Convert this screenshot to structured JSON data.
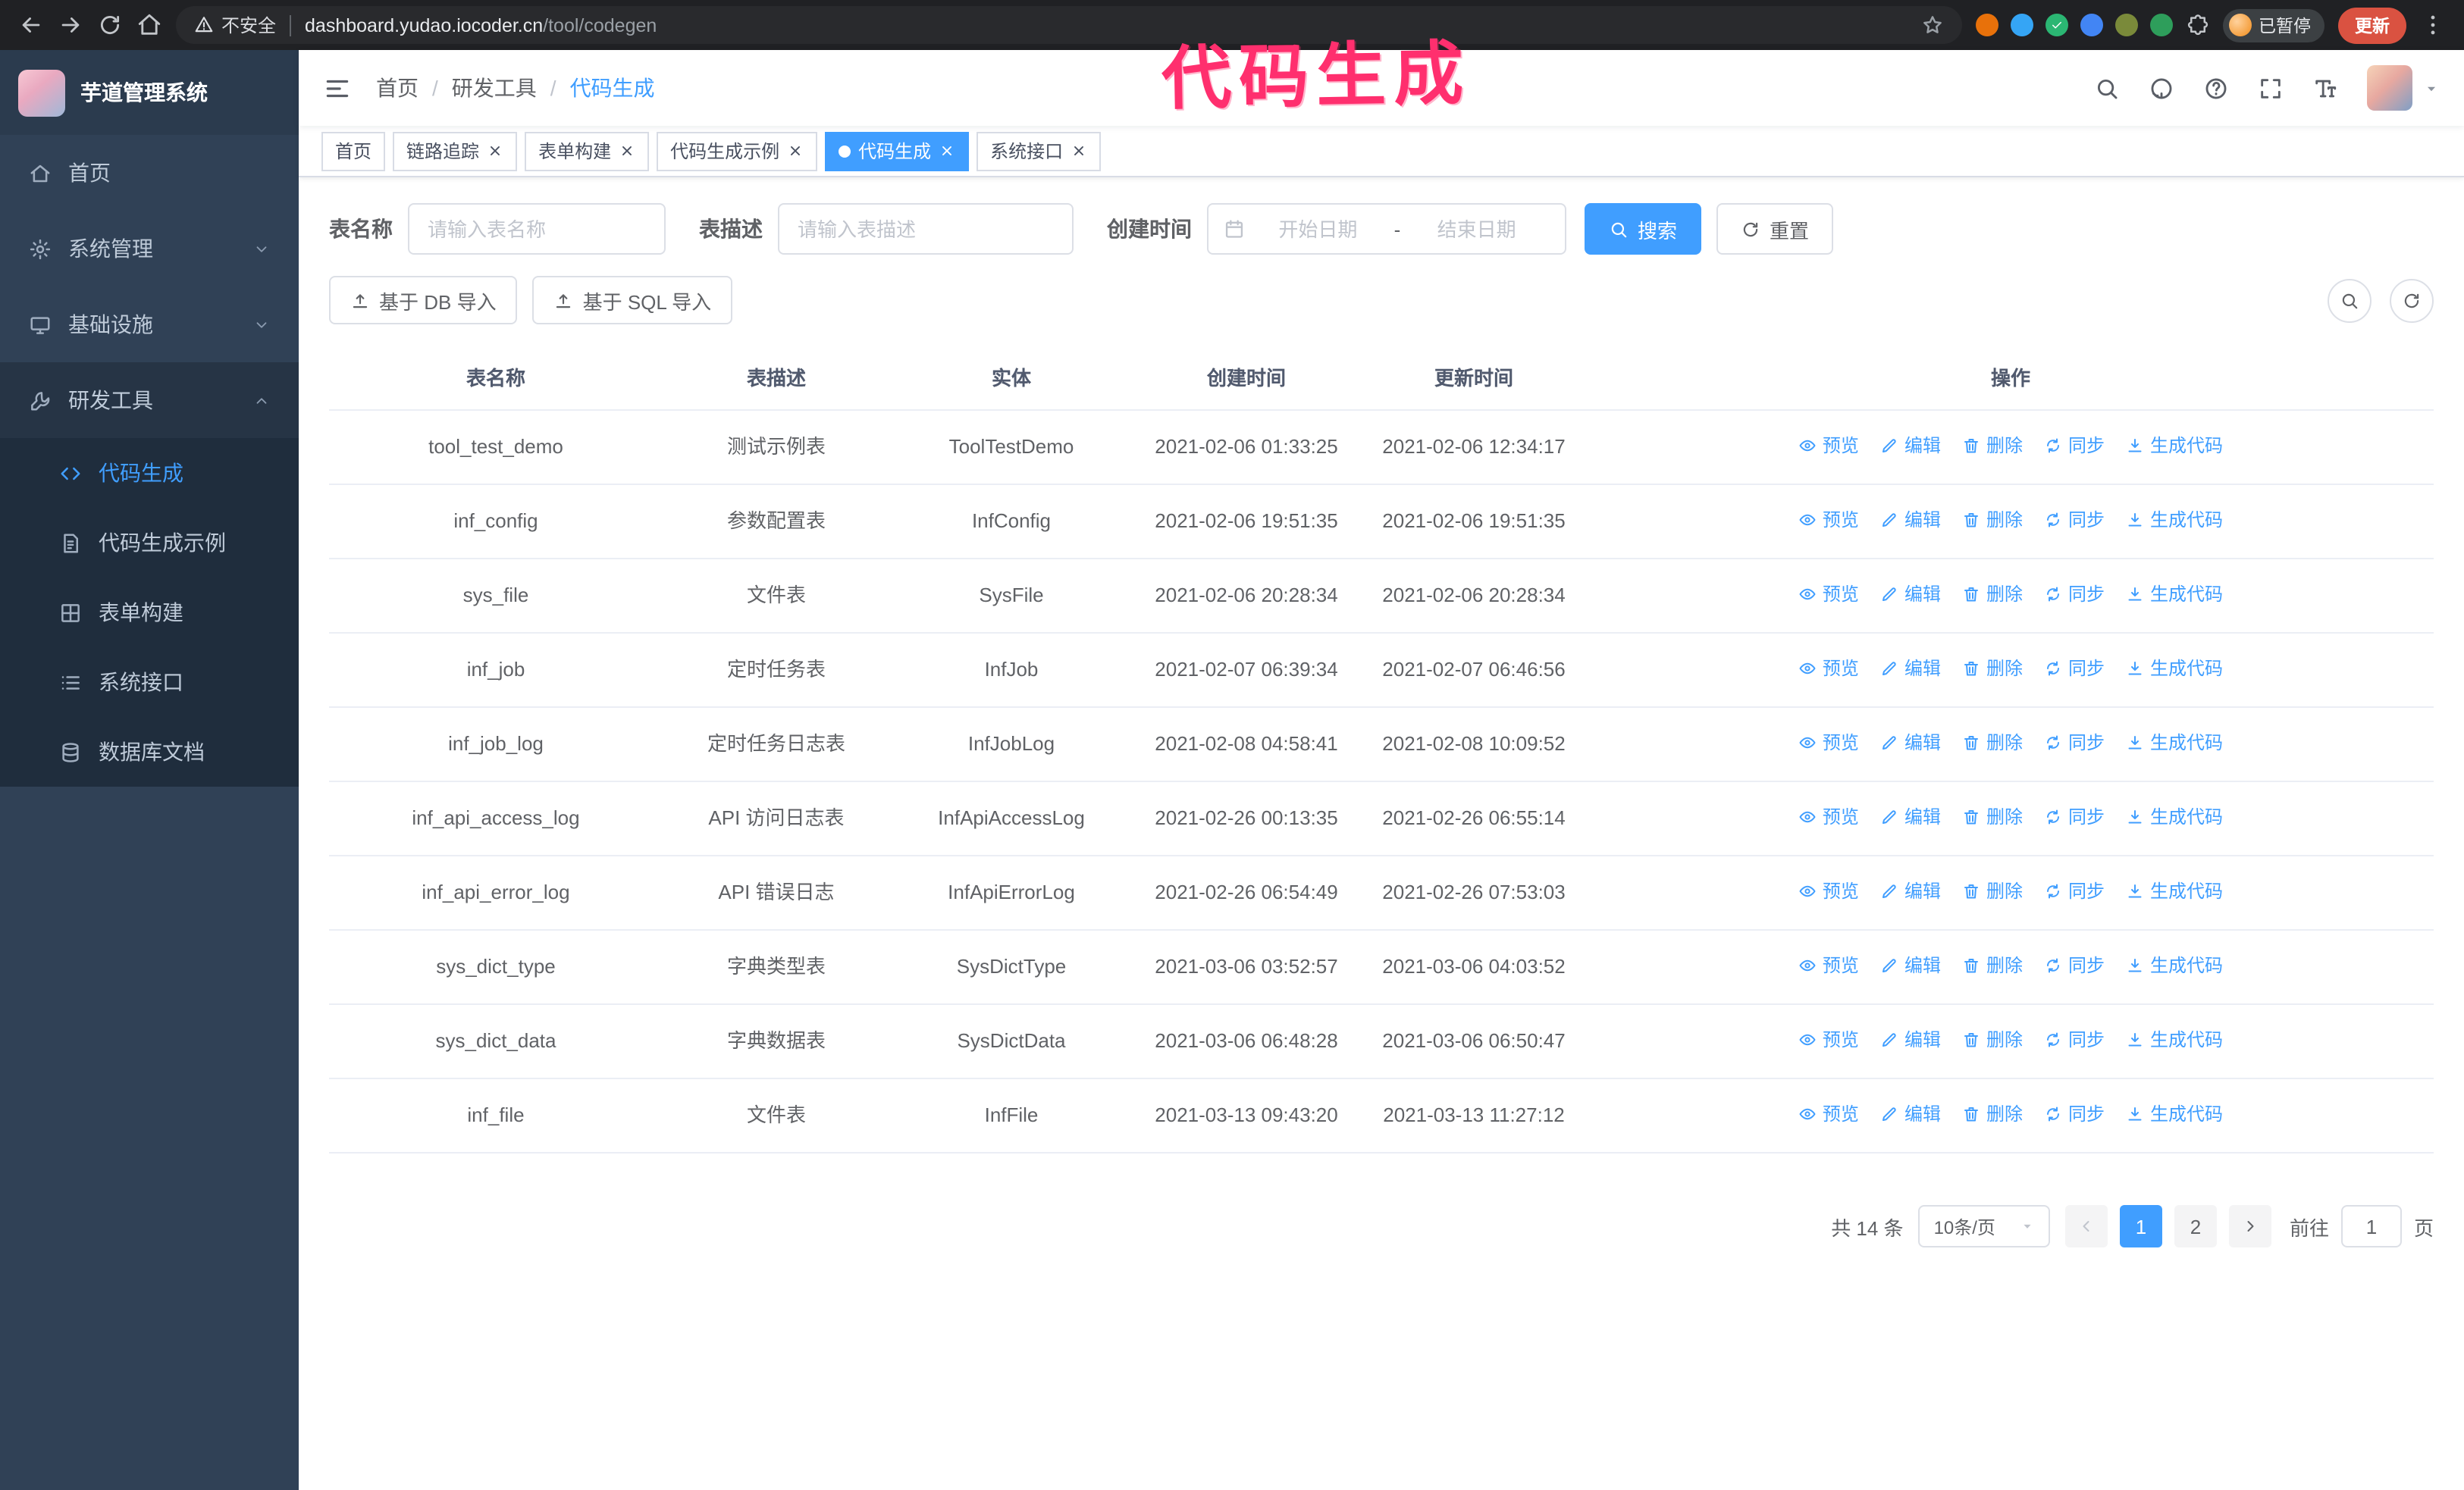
{
  "browser": {
    "security_label": "不安全",
    "url_host": "dashboard.yudao.iocoder.cn",
    "url_path": "/tool/codegen",
    "profile_badge": "已暂停",
    "update_button": "更新",
    "extensions": [
      {
        "name": "extension-icon-1",
        "color": "#e8710a"
      },
      {
        "name": "extension-icon-2",
        "color": "#35a5f5"
      },
      {
        "name": "extension-icon-3",
        "color": "#2bb673",
        "glyph": "check"
      },
      {
        "name": "extension-icon-4",
        "color": "#4285f4"
      },
      {
        "name": "extension-icon-5",
        "color": "#7a8a3a"
      },
      {
        "name": "extension-icon-6",
        "color": "#2e9e5b"
      }
    ]
  },
  "annotation": {
    "text": "代码生成",
    "color": "#ff2f6e"
  },
  "sidebar": {
    "logo_title": "芋道管理系统",
    "items": [
      {
        "key": "home",
        "label": "首页",
        "icon": "home"
      },
      {
        "key": "system",
        "label": "系统管理",
        "icon": "gear",
        "chevron": "down"
      },
      {
        "key": "infra",
        "label": "基础设施",
        "icon": "monitor",
        "chevron": "down"
      },
      {
        "key": "devtools",
        "label": "研发工具",
        "icon": "wrench",
        "chevron": "up",
        "expanded": true
      }
    ],
    "submenu": [
      {
        "key": "codegen",
        "label": "代码生成",
        "icon": "code",
        "active": true
      },
      {
        "key": "codegen-demo",
        "label": "代码生成示例",
        "icon": "doc"
      },
      {
        "key": "form-builder",
        "label": "表单构建",
        "icon": "grid"
      },
      {
        "key": "api-doc",
        "label": "系统接口",
        "icon": "list"
      },
      {
        "key": "db-doc",
        "label": "数据库文档",
        "icon": "database"
      }
    ]
  },
  "breadcrumb": [
    "首页",
    "研发工具",
    "代码生成"
  ],
  "tabs": [
    {
      "key": "home",
      "label": "首页",
      "closable": false,
      "active": false
    },
    {
      "key": "trace",
      "label": "链路追踪",
      "closable": true,
      "active": false
    },
    {
      "key": "form-builder",
      "label": "表单构建",
      "closable": true,
      "active": false
    },
    {
      "key": "codegen-demo",
      "label": "代码生成示例",
      "closable": true,
      "active": false
    },
    {
      "key": "codegen",
      "label": "代码生成",
      "closable": true,
      "active": true
    },
    {
      "key": "api-doc",
      "label": "系统接口",
      "closable": true,
      "active": false
    }
  ],
  "filters": {
    "table_name_label": "表名称",
    "table_name_placeholder": "请输入表名称",
    "table_desc_label": "表描述",
    "table_desc_placeholder": "请输入表描述",
    "create_time_label": "创建时间",
    "date_start_placeholder": "开始日期",
    "date_separator": "-",
    "date_end_placeholder": "结束日期",
    "search_button": "搜索",
    "reset_button": "重置"
  },
  "toolbar": {
    "import_db": "基于 DB 导入",
    "import_sql": "基于 SQL 导入"
  },
  "table": {
    "headers": [
      "表名称",
      "表描述",
      "实体",
      "创建时间",
      "更新时间",
      "操作"
    ],
    "actions": [
      {
        "key": "preview",
        "label": "预览",
        "icon": "eye"
      },
      {
        "key": "edit",
        "label": "编辑",
        "icon": "edit"
      },
      {
        "key": "delete",
        "label": "删除",
        "icon": "trash"
      },
      {
        "key": "sync",
        "label": "同步",
        "icon": "sync"
      },
      {
        "key": "generate-code",
        "label": "生成代码",
        "icon": "download"
      }
    ],
    "rows": [
      {
        "name": "tool_test_demo",
        "desc": "测试示例表",
        "entity": "ToolTestDemo",
        "created": "2021-02-06 01:33:25",
        "updated": "2021-02-06 12:34:17"
      },
      {
        "name": "inf_config",
        "desc": "参数配置表",
        "entity": "InfConfig",
        "created": "2021-02-06 19:51:35",
        "updated": "2021-02-06 19:51:35"
      },
      {
        "name": "sys_file",
        "desc": "文件表",
        "entity": "SysFile",
        "created": "2021-02-06 20:28:34",
        "updated": "2021-02-06 20:28:34"
      },
      {
        "name": "inf_job",
        "desc": "定时任务表",
        "entity": "InfJob",
        "created": "2021-02-07 06:39:34",
        "updated": "2021-02-07 06:46:56"
      },
      {
        "name": "inf_job_log",
        "desc": "定时任务日志表",
        "entity": "InfJobLog",
        "created": "2021-02-08 04:58:41",
        "updated": "2021-02-08 10:09:52"
      },
      {
        "name": "inf_api_access_log",
        "desc": "API 访问日志表",
        "entity": "InfApiAccessLog",
        "created": "2021-02-26 00:13:35",
        "updated": "2021-02-26 06:55:14"
      },
      {
        "name": "inf_api_error_log",
        "desc": "API 错误日志",
        "entity": "InfApiErrorLog",
        "created": "2021-02-26 06:54:49",
        "updated": "2021-02-26 07:53:03"
      },
      {
        "name": "sys_dict_type",
        "desc": "字典类型表",
        "entity": "SysDictType",
        "created": "2021-03-06 03:52:57",
        "updated": "2021-03-06 04:03:52"
      },
      {
        "name": "sys_dict_data",
        "desc": "字典数据表",
        "entity": "SysDictData",
        "created": "2021-03-06 06:48:28",
        "updated": "2021-03-06 06:50:47"
      },
      {
        "name": "inf_file",
        "desc": "文件表",
        "entity": "InfFile",
        "created": "2021-03-13 09:43:20",
        "updated": "2021-03-13 11:27:12"
      }
    ]
  },
  "pagination": {
    "total": "共 14 条",
    "page_size": "10条/页",
    "pages": [
      "1",
      "2"
    ],
    "active_page": "1",
    "goto_label": "前往",
    "goto_value": "1",
    "goto_suffix": "页"
  },
  "colors": {
    "primary": "#409eff",
    "sidebar_bg": "#304156",
    "submenu_bg": "#1f2d3d",
    "active_tab": "#409eff",
    "update_badge": "#da5241",
    "annotation": "#ff2f6e"
  }
}
